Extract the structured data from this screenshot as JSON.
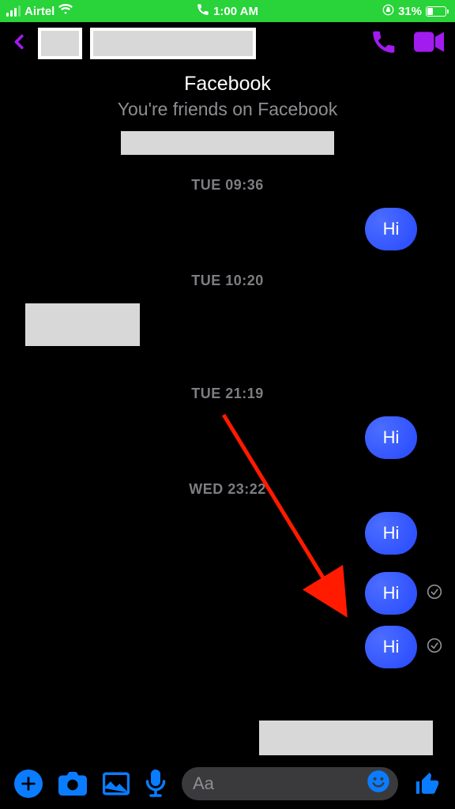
{
  "status": {
    "carrier": "Airtel",
    "time": "1:00 AM",
    "battery_pct": "31%"
  },
  "header": {
    "app_line": "Facebook",
    "friends_line": "You're friends on Facebook"
  },
  "timestamps": {
    "t1": "TUE 09:36",
    "t2": "TUE 10:20",
    "t3": "TUE 21:19",
    "t4": "WED 23:22"
  },
  "messages": {
    "out1": "Hi",
    "out2": "Hi",
    "out3": "Hi",
    "out4": "Hi",
    "out5": "Hi"
  },
  "composer": {
    "placeholder": "Aa"
  }
}
